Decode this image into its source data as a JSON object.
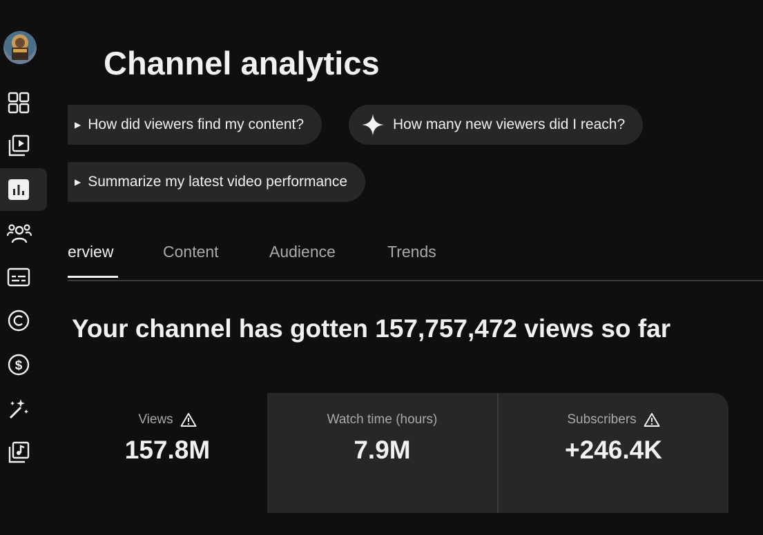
{
  "sidebar": {
    "items": [
      {
        "icon": "dashboard-icon",
        "active": false
      },
      {
        "icon": "content-icon",
        "active": false
      },
      {
        "icon": "analytics-icon",
        "active": true
      },
      {
        "icon": "community-icon",
        "active": false
      },
      {
        "icon": "subtitles-icon",
        "active": false
      },
      {
        "icon": "copyright-icon",
        "active": false
      },
      {
        "icon": "earn-icon",
        "active": false
      },
      {
        "icon": "customization-icon",
        "active": false
      },
      {
        "icon": "audio-library-icon",
        "active": false
      }
    ]
  },
  "header": {
    "title": "Channel analytics"
  },
  "suggestions": [
    "How did viewers find my content?",
    "How many new viewers did I reach?",
    "Summarize my latest video performance"
  ],
  "tabs": [
    "erview",
    "Content",
    "Audience",
    "Trends"
  ],
  "summary": {
    "headline": "Your channel has gotten 157,757,472 views so far"
  },
  "stats": [
    {
      "label": "Views",
      "value": "157.8M",
      "warning": true
    },
    {
      "label": "Watch time (hours)",
      "value": "7.9M",
      "warning": false
    },
    {
      "label": "Subscribers",
      "value": "+246.4K",
      "warning": true
    }
  ],
  "colors": {
    "background": "#0f0f0f",
    "surface": "#272727",
    "text": "#f1f1f1",
    "muted": "#aaaaaa"
  }
}
